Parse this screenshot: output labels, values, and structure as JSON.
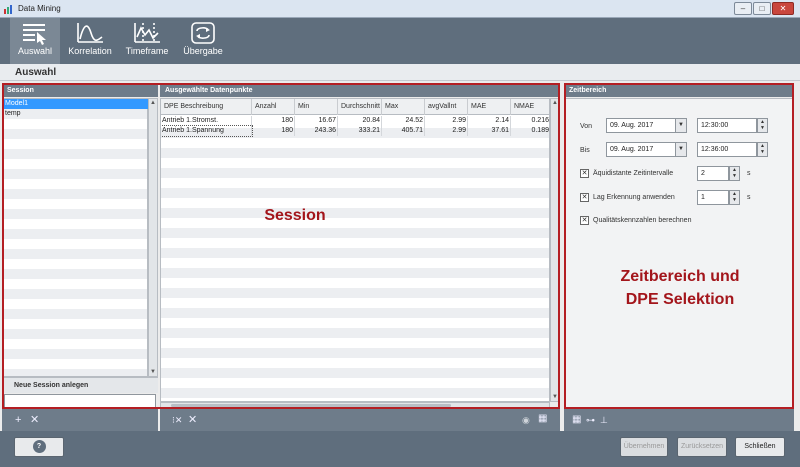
{
  "window": {
    "title": "Data Mining",
    "buttons": [
      "–",
      "□",
      "✕"
    ]
  },
  "toolbar": {
    "items": [
      {
        "label": "Auswahl",
        "icon": "selection-icon",
        "active": true
      },
      {
        "label": "Korrelation",
        "icon": "correlation-curve-icon",
        "active": false
      },
      {
        "label": "Timeframe",
        "icon": "timeframe-chart-icon",
        "active": false
      },
      {
        "label": "Übergabe",
        "icon": "transfer-arrows-icon",
        "active": false
      }
    ]
  },
  "subheader": {
    "title": "Auswahl"
  },
  "session": {
    "header": "Session",
    "items": [
      "Model1",
      "temp"
    ],
    "selected": 0,
    "new_session_label": "Neue Session anlegen",
    "new_session_value": ""
  },
  "datapoints": {
    "header": "Ausgewählte Datenpunkte",
    "columns": [
      "DPE Beschreibung",
      "Anzahl",
      "Min",
      "Durchschnitt",
      "Max",
      "avgVallnt",
      "MAE",
      "NMAE"
    ],
    "rows": [
      [
        "Antrieb 1.Stromst.",
        "180",
        "16.67",
        "20.84",
        "24.52",
        "2.99",
        "2.14",
        "0.216"
      ],
      [
        "Antrieb 1.Spannung",
        "180",
        "243.36",
        "333.21",
        "405.71",
        "2.99",
        "37.61",
        "0.189"
      ]
    ]
  },
  "zeitbereich": {
    "header": "Zeitbereich",
    "von_label": "Von",
    "von_date": "09. Aug. 2017",
    "von_time": "12:30:00",
    "bis_label": "Bis",
    "bis_date": "09. Aug. 2017",
    "bis_time": "12:36:00",
    "aequi_label": "Äquidistante Zeitintervalle",
    "aequi_value": "2",
    "aequi_unit": "s",
    "aequi_checked": true,
    "lag_label": "Lag Erkennung anwenden",
    "lag_value": "1",
    "lag_unit": "s",
    "lag_checked": true,
    "qual_label": "Qualitätskennzahlen berechnen",
    "qual_checked": true
  },
  "annotations": {
    "session_label": "Session",
    "zeitbereich_label_line1": "Zeitbereich und",
    "zeitbereich_label_line2": "DPE Selektion",
    "color": "#b41e23"
  },
  "bottom": {
    "help": "?",
    "apply": "Übernehmen",
    "reset": "Zurücksetzen",
    "close": "Schließen"
  }
}
